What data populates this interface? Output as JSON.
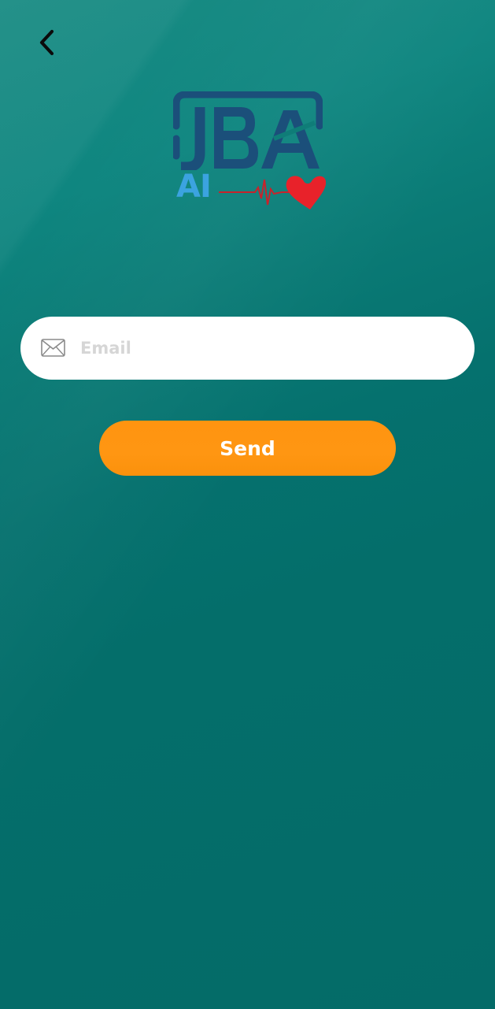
{
  "app": {
    "logo_text": "JBA",
    "logo_subtext": "AI"
  },
  "nav": {
    "back_icon": "chevron-left-icon"
  },
  "form": {
    "email_placeholder": "Email",
    "email_value": "",
    "email_icon": "envelope-icon",
    "send_label": "Send"
  },
  "colors": {
    "background": "#046e6a",
    "background_top": "#1a8c84",
    "button": "#ff9612",
    "logo_dark": "#1b4f7a",
    "logo_ai": "#3ba3e0",
    "heart": "#e8222a"
  }
}
